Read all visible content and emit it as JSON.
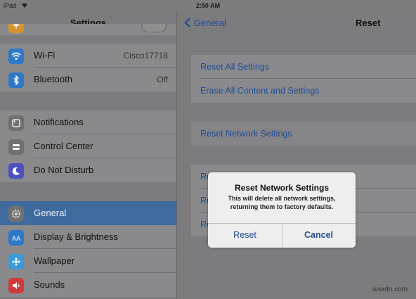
{
  "status": {
    "carrier": "iPad",
    "time": "2:50 AM"
  },
  "sidebar": {
    "title": "Settings",
    "items": [
      {
        "label": "",
        "value": "",
        "icon": "airplane-icon",
        "color": "#d9902e"
      },
      {
        "label": "Wi-Fi",
        "value": "Cisco17718",
        "icon": "wifi-icon",
        "color": "#2d78c8"
      },
      {
        "label": "Bluetooth",
        "value": "Off",
        "icon": "bluetooth-icon",
        "color": "#2d78c8"
      },
      {
        "label": "Notifications",
        "value": "",
        "icon": "notifications-icon",
        "color": "#707070"
      },
      {
        "label": "Control Center",
        "value": "",
        "icon": "control-center-icon",
        "color": "#707070"
      },
      {
        "label": "Do Not Disturb",
        "value": "",
        "icon": "moon-icon",
        "color": "#4f4fc0"
      },
      {
        "label": "General",
        "value": "",
        "icon": "gear-icon",
        "color": "#707070"
      },
      {
        "label": "Display & Brightness",
        "value": "",
        "icon": "display-icon",
        "color": "#2d78c8"
      },
      {
        "label": "Wallpaper",
        "value": "",
        "icon": "wallpaper-icon",
        "color": "#3b9ad9"
      },
      {
        "label": "Sounds",
        "value": "",
        "icon": "sound-icon",
        "color": "#d03a3a"
      }
    ]
  },
  "detail": {
    "back_label": "General",
    "title": "Reset",
    "items": [
      {
        "label": "Reset All Settings"
      },
      {
        "label": "Erase All Content and Settings"
      },
      {
        "label": "Reset Network Settings"
      },
      {
        "label": "Re"
      },
      {
        "label": "Re"
      },
      {
        "label": "Re"
      }
    ]
  },
  "alert": {
    "title": "Reset Network Settings",
    "message": "This will delete all network settings, returning them to factory defaults.",
    "reset_label": "Reset",
    "cancel_label": "Cancel"
  },
  "watermark": "wsxdn.com"
}
